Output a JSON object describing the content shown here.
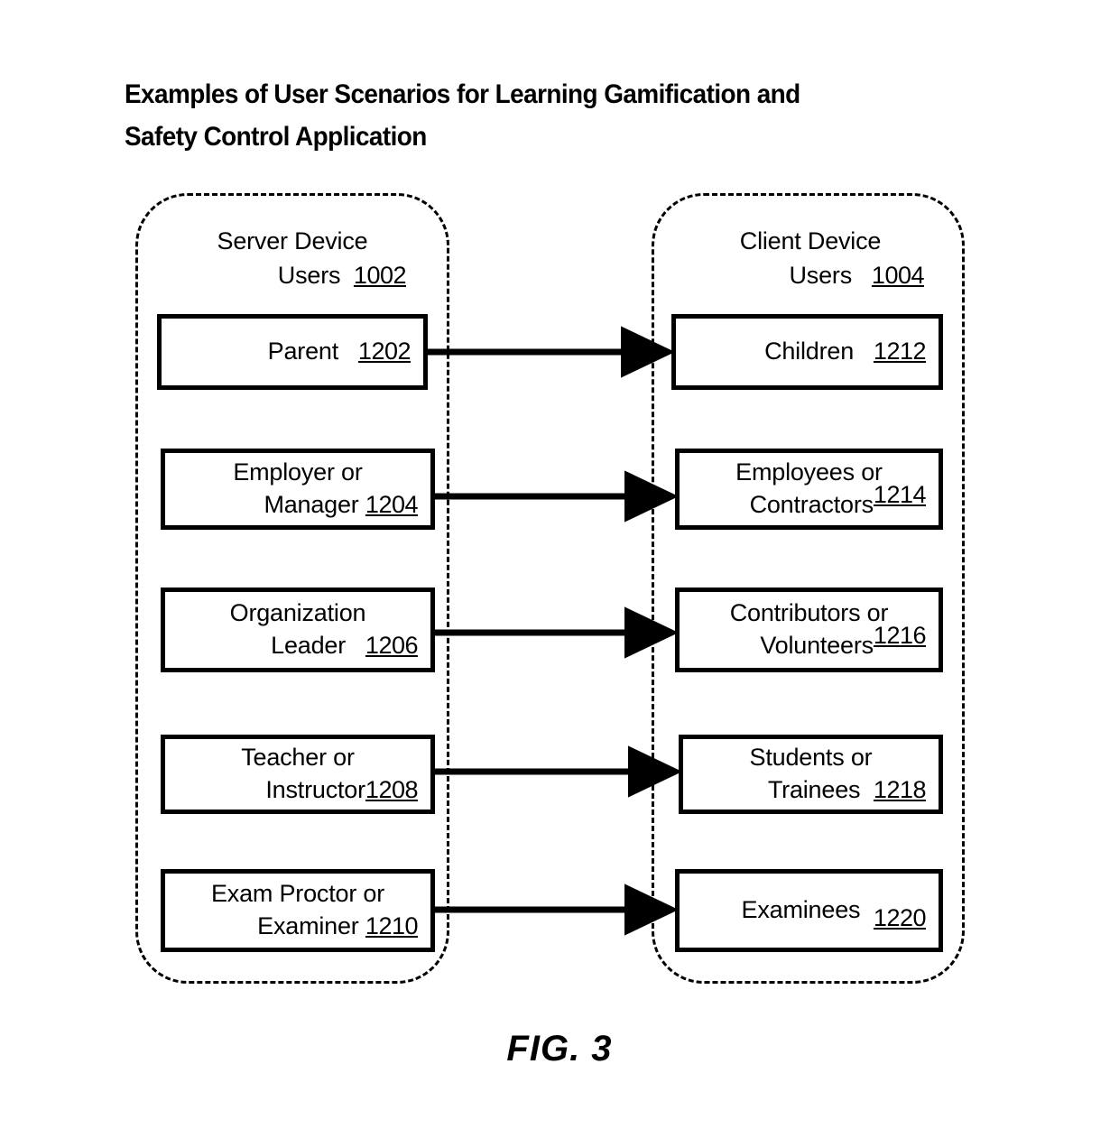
{
  "figure": {
    "title_line_1": "Examples of User Scenarios for Learning Gamification and",
    "title_line_2": "Safety Control Application",
    "caption": "FIG. 3"
  },
  "groups": {
    "server": {
      "heading_line_1": "Server Device",
      "heading_line_2": "Users",
      "heading_ref": "1002"
    },
    "client": {
      "heading_line_1": "Client Device",
      "heading_line_2": "Users",
      "heading_ref": "1004"
    }
  },
  "rows": [
    {
      "server": {
        "line_1": "Parent",
        "line_2": "",
        "ref": "1202"
      },
      "client": {
        "line_1": "Children",
        "line_2": "",
        "ref": "1212"
      }
    },
    {
      "server": {
        "line_1": "Employer or",
        "line_2": "Manager",
        "ref": "1204"
      },
      "client": {
        "line_1": "Employees or",
        "line_2": "Contractors",
        "ref": "1214"
      }
    },
    {
      "server": {
        "line_1": "Organization",
        "line_2": "Leader",
        "ref": "1206"
      },
      "client": {
        "line_1": "Contributors or",
        "line_2": "Volunteers",
        "ref": "1216"
      }
    },
    {
      "server": {
        "line_1": "Teacher or",
        "line_2": "Instructor",
        "ref": "1208"
      },
      "client": {
        "line_1": "Students or",
        "line_2": "Trainees",
        "ref": "1218"
      }
    },
    {
      "server": {
        "line_1": "Exam Proctor or",
        "line_2": "Examiner",
        "ref": "1210"
      },
      "client": {
        "line_1": "Examinees",
        "line_2": "",
        "ref": "1220"
      }
    }
  ],
  "connectors": {
    "count": 5,
    "direction": "server-to-client",
    "style": "solid-arrow"
  },
  "colors": {
    "stroke": "#000000",
    "background": "#ffffff"
  }
}
